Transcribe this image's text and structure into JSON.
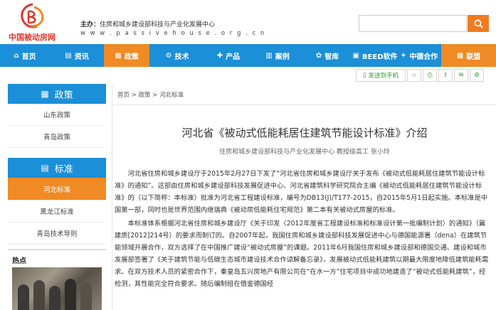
{
  "header": {
    "logo_text": "中国被动房网",
    "sponsor_label": "主办：",
    "sponsor_name": "住房和城乡建设部科技与产业化发展中心",
    "site_url": "w w w . p a s s i v e h o u s e . o r g . c n",
    "search_placeholder": ""
  },
  "nav": {
    "items": [
      {
        "label": "首页",
        "icon": "home-icon"
      },
      {
        "label": "资讯",
        "icon": "news-icon"
      },
      {
        "label": "政策",
        "icon": "policy-icon"
      },
      {
        "label": "技术",
        "icon": "gear-icon"
      },
      {
        "label": "产品",
        "icon": "cart-icon"
      },
      {
        "label": "案例",
        "icon": "building-icon"
      },
      {
        "label": "智库",
        "icon": "brain-icon"
      },
      {
        "label": "BEED软件",
        "icon": "software-icon"
      },
      {
        "label": "中德合作",
        "icon": "handshake-icon"
      },
      {
        "label": "联盟",
        "icon": "alliance-icon"
      }
    ],
    "active_index": 2
  },
  "toolbar": {
    "send_to_phone": "发送到手机"
  },
  "sidebar": {
    "policy_title": "政策",
    "policy_items": [
      "山东政策",
      "青岛政策"
    ],
    "standard_title": "标准",
    "standard_items": [
      "河北标准",
      "黑龙江标准",
      "青岛技术导则"
    ],
    "active_standard": "河北标准",
    "hot_title": "热点"
  },
  "breadcrumb": {
    "home": "首页",
    "sep1": " > ",
    "level1": "政策",
    "sep2": " > ",
    "level2": "河北标准"
  },
  "article": {
    "title": "河北省《被动式低能耗居住建筑节能设计标准》介绍",
    "meta": "住房和城乡建设部科技与产业化发展中心 教授级高工 张小玲",
    "paragraphs": [
      "河北省住房和城乡建设厅于2015年2月27日下发了“河北省住房和城乡建设厅关于发布《被动式低能耗居住建筑节能设计标准》的通知”。这部由住房和城乡建设部科技发展促进中心、河北省建筑科学研究院合主编《被动式低能耗居住建筑节能设计标准》的（以下简称：本标准）批准为河北省工程建设标准，编号为DB13(J)/T177-2015，自2015年5月1日起实施。本标准是中国第一部，同时也是世界范围内继瑞典《被动房低能耗住宅规范》第二本有关被动式房屋的标准。",
      "本标准体系根据河北省住房和城乡建设厅《关于印发〈2012年度省工程建设标准和标准设计第一批编制计划〉的通知》（冀建质[2012]214号）的要求而制订的。自2007年起，我国住房和城乡建设部科技发展促进中心与德国能源署（dena）在建筑节能领域开展合作，双方选择了在中国推广建设“被动式房屋”的课题。2011年6月我国住房和城乡建设部和德国交通、建设和城市发展部签署了《关于建筑节能与低碳生态城市建设技术合作谅解备忘录》，发展被动式低能耗建筑以期最大限度地降低建筑能耗需求。在双方技术人员的紧密合作下，秦皇岛五兴房地产有限公司在“在水一方”住宅项目中成功地建造了“被动式低能耗建筑”，经检测，其性能完全符合要求。随后编制组在借鉴德国经"
    ]
  },
  "colors": {
    "nav_blue": "#1b8fd8",
    "accent_orange": "#f08a24",
    "logo_red": "#e0362c"
  }
}
